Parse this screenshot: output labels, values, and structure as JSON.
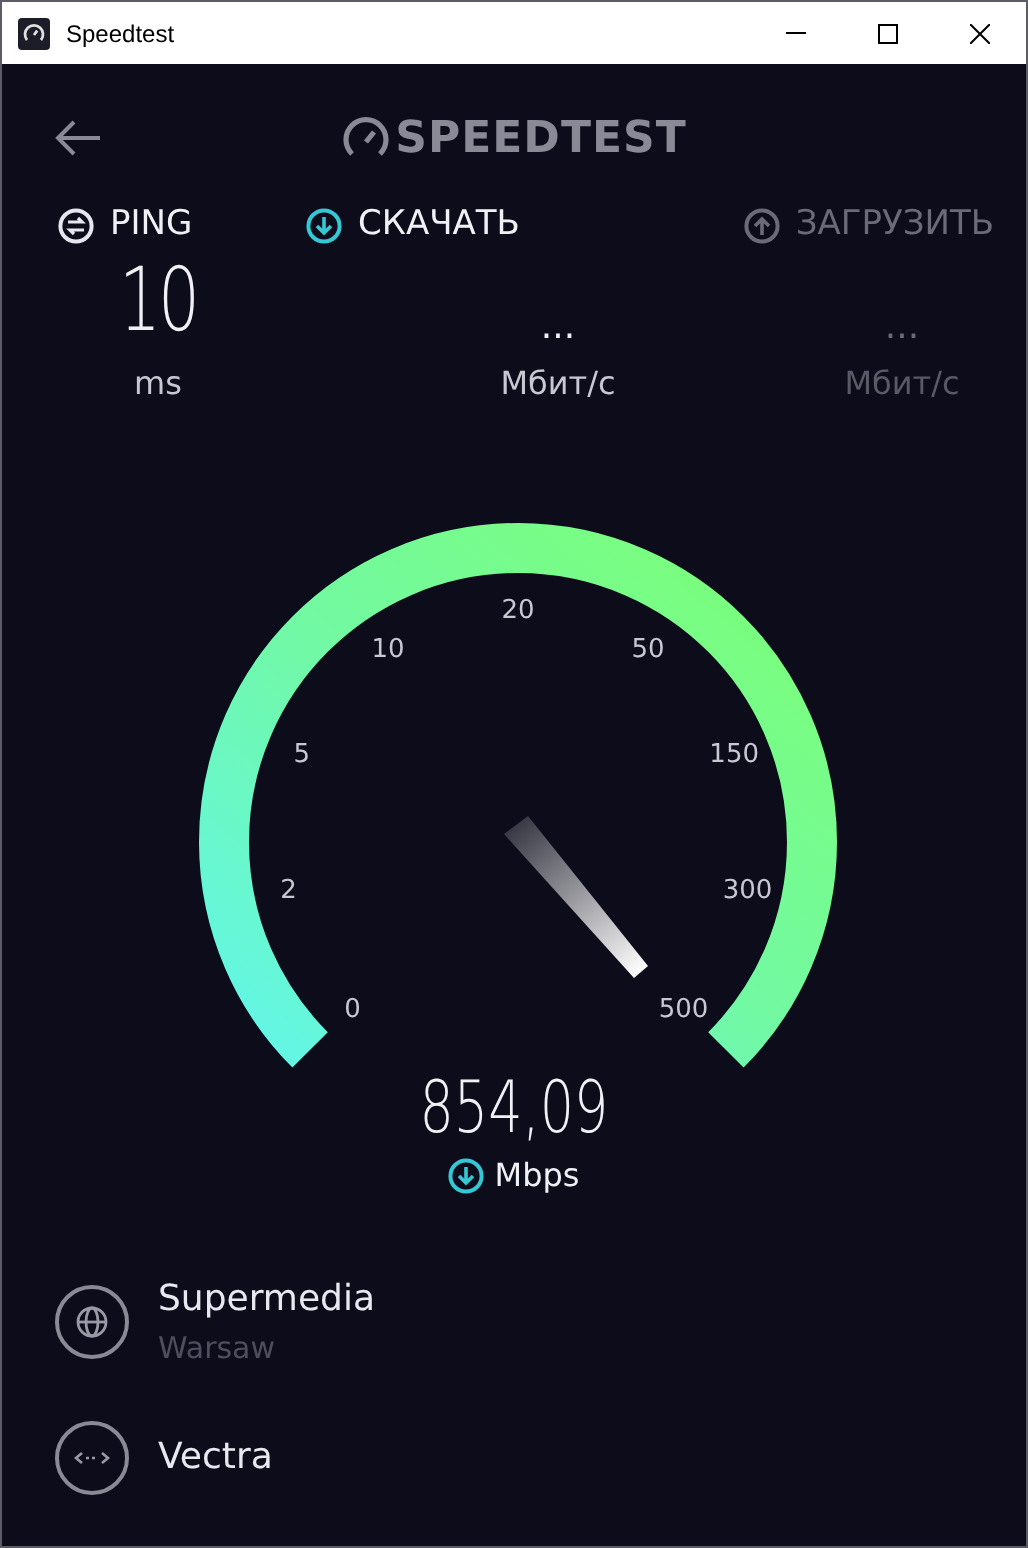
{
  "window": {
    "title": "Speedtest"
  },
  "header": {
    "logo": "SPEEDTEST"
  },
  "metrics": [
    {
      "kind": "ping",
      "label": "PING",
      "value": "10",
      "unit": "ms",
      "active": true
    },
    {
      "kind": "download",
      "label": "СКАЧАТЬ",
      "value": "...",
      "unit": "Мбит/с",
      "active": true
    },
    {
      "kind": "upload",
      "label": "ЗАГРУЗИТЬ",
      "value": "...",
      "unit": "Мбит/с",
      "active": false
    }
  ],
  "gauge": {
    "ticks": [
      "0",
      "2",
      "5",
      "10",
      "20",
      "50",
      "150",
      "300",
      "500"
    ],
    "reading": "854,09",
    "unit": "Mbps"
  },
  "servers": [
    {
      "kind": "globe",
      "name": "Supermedia",
      "location": "Warsaw"
    },
    {
      "kind": "link",
      "name": "Vectra"
    }
  ]
}
